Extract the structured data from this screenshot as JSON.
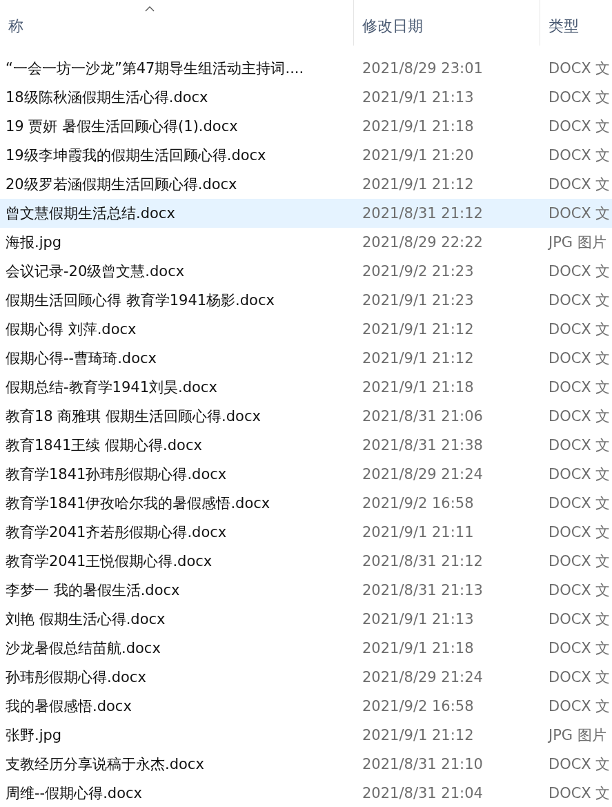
{
  "columns": [
    {
      "label": "称",
      "sorted": true
    },
    {
      "label": "修改日期",
      "sorted": false
    },
    {
      "label": "类型",
      "sorted": false
    }
  ],
  "rows": [
    {
      "name": "“一会一坊一沙龙”第47期导生组活动主持词....",
      "modified": "2021/8/29 23:01",
      "type": "DOCX 文",
      "selected": false
    },
    {
      "name": "18级陈秋涵假期生活心得.docx",
      "modified": "2021/9/1 21:13",
      "type": "DOCX 文",
      "selected": false
    },
    {
      "name": "19 贾妍 暑假生活回顾心得(1).docx",
      "modified": "2021/9/1 21:18",
      "type": "DOCX 文",
      "selected": false
    },
    {
      "name": "19级李坤霞我的假期生活回顾心得.docx",
      "modified": "2021/9/1 21:20",
      "type": "DOCX 文",
      "selected": false
    },
    {
      "name": "20级罗若涵假期生活回顾心得.docx",
      "modified": "2021/9/1 21:12",
      "type": "DOCX 文",
      "selected": false
    },
    {
      "name": "曾文慧假期生活总结.docx",
      "modified": "2021/8/31 21:12",
      "type": "DOCX 文",
      "selected": true
    },
    {
      "name": "海报.jpg",
      "modified": "2021/8/29 22:22",
      "type": "JPG 图片",
      "selected": false
    },
    {
      "name": "会议记录-20级曾文慧.docx",
      "modified": "2021/9/2 21:23",
      "type": "DOCX 文",
      "selected": false
    },
    {
      "name": "假期生活回顾心得 教育学1941杨影.docx",
      "modified": "2021/9/1 21:23",
      "type": "DOCX 文",
      "selected": false
    },
    {
      "name": "假期心得  刘萍.docx",
      "modified": "2021/9/1 21:12",
      "type": "DOCX 文",
      "selected": false
    },
    {
      "name": "假期心得--曹琦琦.docx",
      "modified": "2021/9/1 21:12",
      "type": "DOCX 文",
      "selected": false
    },
    {
      "name": "假期总结-教育学1941刘昊.docx",
      "modified": "2021/9/1 21:18",
      "type": "DOCX 文",
      "selected": false
    },
    {
      "name": "教育18 商雅琪 假期生活回顾心得.docx",
      "modified": "2021/8/31 21:06",
      "type": "DOCX 文",
      "selected": false
    },
    {
      "name": "教育1841王续 假期心得.docx",
      "modified": "2021/8/31 21:38",
      "type": "DOCX 文",
      "selected": false
    },
    {
      "name": "教育学1841孙玮彤假期心得.docx",
      "modified": "2021/8/29 21:24",
      "type": "DOCX 文",
      "selected": false
    },
    {
      "name": "教育学1841伊孜哈尔我的暑假感悟.docx",
      "modified": "2021/9/2 16:58",
      "type": "DOCX 文",
      "selected": false
    },
    {
      "name": "教育学2041齐若彤假期心得.docx",
      "modified": "2021/9/1 21:11",
      "type": "DOCX 文",
      "selected": false
    },
    {
      "name": "教育学2041王悦假期心得.docx",
      "modified": "2021/8/31 21:12",
      "type": "DOCX 文",
      "selected": false
    },
    {
      "name": "李梦一  我的暑假生活.docx",
      "modified": "2021/8/31 21:13",
      "type": "DOCX 文",
      "selected": false
    },
    {
      "name": "刘艳  假期生活心得.docx",
      "modified": "2021/9/1 21:13",
      "type": "DOCX 文",
      "selected": false
    },
    {
      "name": "沙龙暑假总结苗航.docx",
      "modified": "2021/9/1 21:18",
      "type": "DOCX 文",
      "selected": false
    },
    {
      "name": "孙玮彤假期心得.docx",
      "modified": "2021/8/29 21:24",
      "type": "DOCX 文",
      "selected": false
    },
    {
      "name": "我的暑假感悟.docx",
      "modified": "2021/9/2 16:58",
      "type": "DOCX 文",
      "selected": false
    },
    {
      "name": "张野.jpg",
      "modified": "2021/9/1 21:12",
      "type": "JPG 图片",
      "selected": false
    },
    {
      "name": "支教经历分享说稿于永杰.docx",
      "modified": "2021/8/31 21:10",
      "type": "DOCX 文",
      "selected": false
    },
    {
      "name": "周维--假期心得.docx",
      "modified": "2021/8/31 21:04",
      "type": "DOCX 文",
      "selected": false
    }
  ]
}
